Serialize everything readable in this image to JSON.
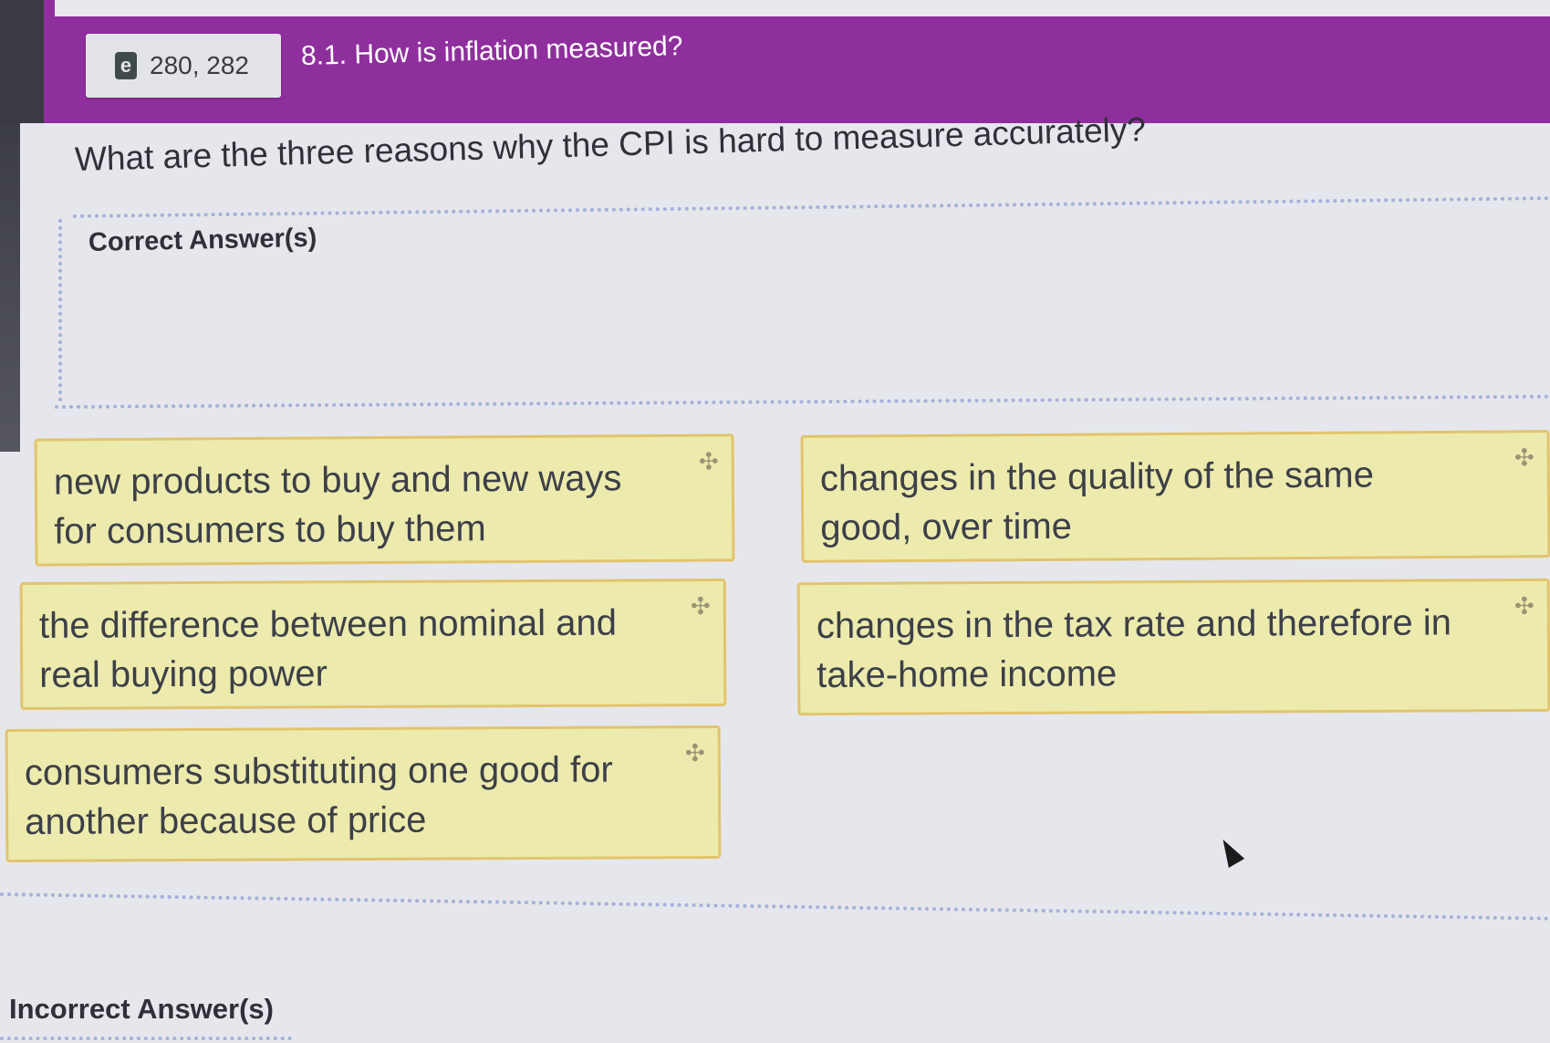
{
  "header": {
    "page_numbers": "280, 282",
    "ebook_icon_glyph": "e",
    "section_title": "8.1. How is inflation measured?"
  },
  "question": "What are the three reasons why the CPI is hard to measure accurately?",
  "correct_zone_label": "Correct Answer(s)",
  "incorrect_zone_label": "Incorrect Answer(s)",
  "cards": [
    {
      "text": "new products to buy and new ways for consumers to buy them"
    },
    {
      "text": "changes in the quality of the same good, over time"
    },
    {
      "text": "the difference between nominal and real buying power"
    },
    {
      "text": "changes in the tax rate and therefore in take-home income"
    },
    {
      "text": "consumers substituting one good for another because of price"
    }
  ],
  "drag_handle_glyph": "✣",
  "colors": {
    "header_purple": "#8f2f9d",
    "card_fill": "#ecebad",
    "card_border": "#e2c46d",
    "dotted_border": "#a4b1d9"
  }
}
